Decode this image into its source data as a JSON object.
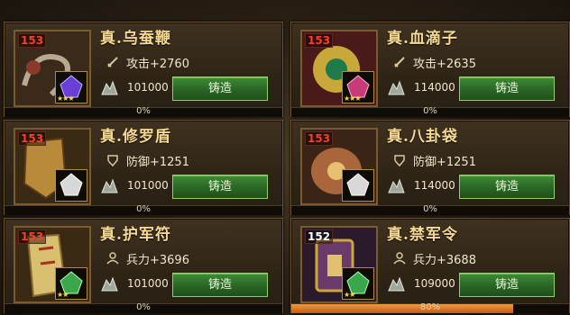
{
  "cards": [
    {
      "level": "153",
      "title": "真.乌蚕鞭",
      "stat_type": "attack",
      "stat": "攻击+2760",
      "cost": "101000",
      "button": "铸造",
      "progress_label": "0%",
      "progress": 0,
      "stars": "★★★",
      "art_color": "#6a5a4a",
      "gem_color": "#6a3fd8"
    },
    {
      "level": "153",
      "title": "真.血滴子",
      "stat_type": "attack",
      "stat": "攻击+2635",
      "cost": "114000",
      "button": "铸造",
      "progress_label": "0%",
      "progress": 0,
      "stars": "★★★",
      "art_color": "#c9a83a",
      "gem_color": "#c83a7a"
    },
    {
      "level": "153",
      "title": "真.修罗盾",
      "stat_type": "defense",
      "stat": "防御+1251",
      "cost": "101000",
      "button": "铸造",
      "progress_label": "0%",
      "progress": 0,
      "stars": "",
      "art_color": "#b88a3a",
      "gem_color": "#d8d8d8"
    },
    {
      "level": "153",
      "title": "真.八卦袋",
      "stat_type": "defense",
      "stat": "防御+1251",
      "cost": "114000",
      "button": "铸造",
      "progress_label": "0%",
      "progress": 0,
      "stars": "",
      "art_color": "#a8663a",
      "gem_color": "#d8d8d8"
    },
    {
      "level": "153",
      "title": "真.护军符",
      "stat_type": "troops",
      "stat": "兵力+3696",
      "cost": "101000",
      "button": "铸造",
      "progress_label": "0%",
      "progress": 0,
      "stars": "★★",
      "art_color": "#d8c070",
      "gem_color": "#3aa84a"
    },
    {
      "level": "152",
      "title": "真.禁军令",
      "stat_type": "troops",
      "stat": "兵力+3688",
      "cost": "109000",
      "button": "铸造",
      "progress_label": "80%",
      "progress": 0.8,
      "stars": "★★",
      "art_color": "#6a3a6a",
      "gem_color": "#3aa84a"
    }
  ],
  "colors": {
    "title": "#f6d993",
    "level": "#ff3b2b",
    "button_green": "#2f6d28",
    "progress_fill": "#e07a26"
  }
}
